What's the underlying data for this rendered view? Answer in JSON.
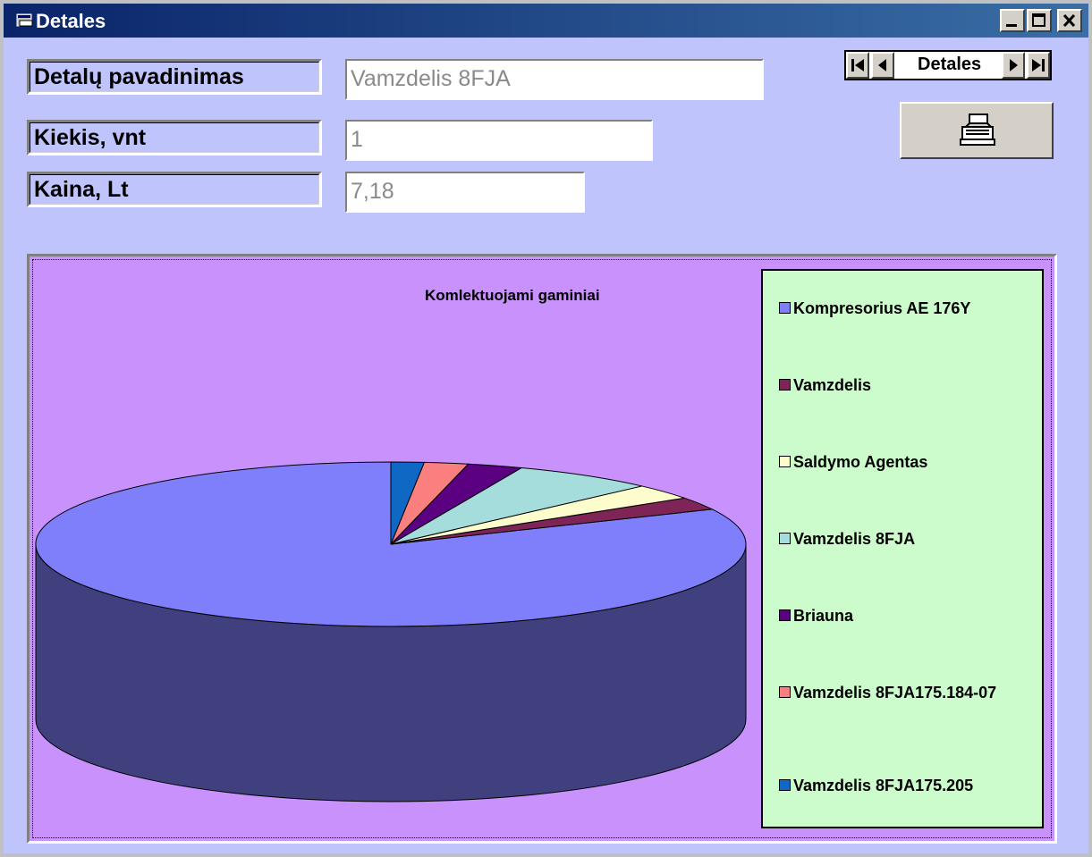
{
  "window": {
    "title": "Detales"
  },
  "form": {
    "fields": [
      {
        "label": "Detalų pavadinimas",
        "value": "Vamzdelis 8FJA"
      },
      {
        "label": "Kiekis, vnt",
        "value": "1"
      },
      {
        "label": "Kaina, Lt",
        "value": "7,18"
      }
    ]
  },
  "navigator": {
    "caption": "Detales"
  },
  "colors": {
    "client_bg": "#c0c4fc",
    "chart_bg": "#c891fc",
    "legend_bg": "#ccfccc"
  },
  "chart_data": {
    "type": "pie",
    "title": "Komlektuojami gaminiai",
    "legend_position": "right",
    "categories": [
      "Kompresorius AE 176Y",
      "Vamzdelis",
      "Saldymo Agentas",
      "Vamzdelis 8FJA",
      "Briauna",
      "Vamzdelis 8FJA175.184-07",
      "Vamzdelis 8FJA175.205"
    ],
    "values": [
      82,
      2.5,
      3,
      6.5,
      2.5,
      2,
      1.5
    ],
    "colors": [
      "#7f7ffc",
      "#7f2457",
      "#fdfccc",
      "#a5dcdc",
      "#5a0080",
      "#fc7f7f",
      "#0f69c4"
    ]
  }
}
